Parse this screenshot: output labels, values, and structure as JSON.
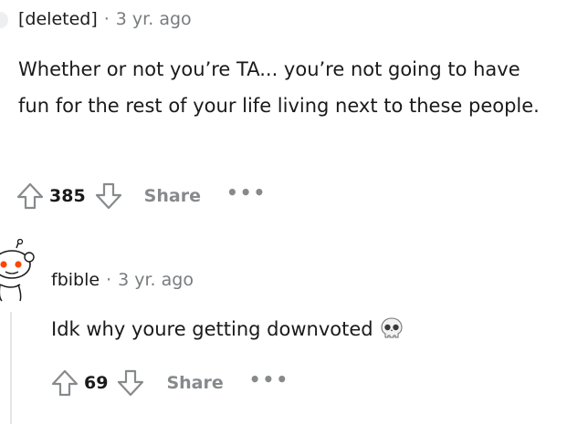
{
  "comments": [
    {
      "author": "[deleted]",
      "separator": "·",
      "time": "3 yr. ago",
      "body": "Whether or not you’re TA... you’re not going to have fun for the rest of your life living next to these people.",
      "score": "385",
      "share_label": "Share",
      "more_label": "•••"
    },
    {
      "author": "fbible",
      "separator": "·",
      "time": "3 yr. ago",
      "body": "Idk why youre getting downvoted",
      "emoji": "skull-emoji",
      "score": "69",
      "share_label": "Share",
      "more_label": "•••"
    }
  ],
  "colors": {
    "text": "#1a1a1b",
    "meta": "#787c7e",
    "action": "#878a8c",
    "snoo_orange": "#ff4500",
    "thread_line": "#e5e5e5"
  }
}
